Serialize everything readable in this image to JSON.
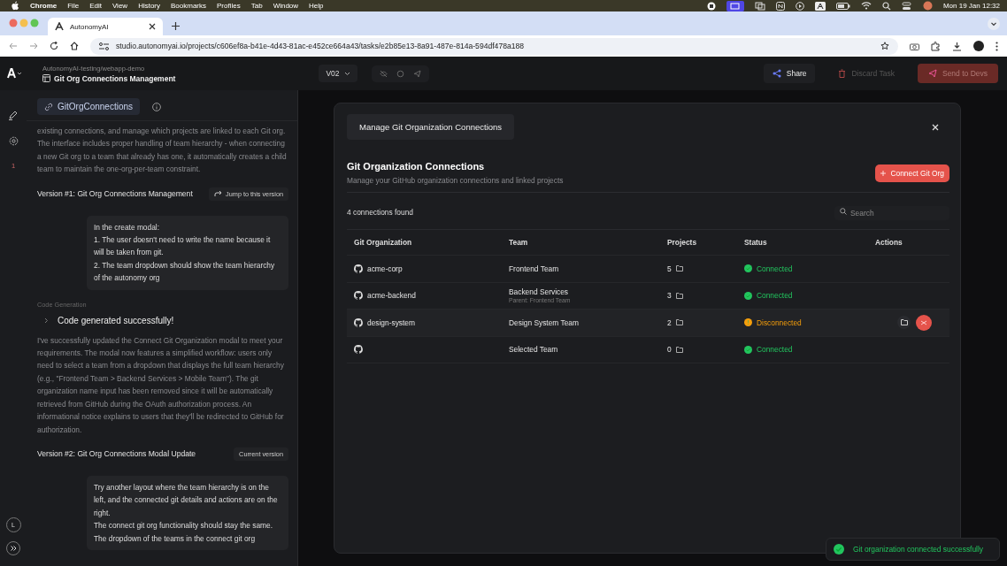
{
  "menu_bar": {
    "app": "Chrome",
    "menus": [
      "File",
      "Edit",
      "View",
      "History",
      "Bookmarks",
      "Profiles",
      "Tab",
      "Window",
      "Help"
    ],
    "clock": "Mon 19 Jan  12:32"
  },
  "browser": {
    "tab_title": "AutonomyAI",
    "url": "studio.autonomyai.io/projects/c606ef8a-b41e-4d43-81ac-e452ce664a43/tasks/e2b85e13-8a91-487e-814a-594df478a188"
  },
  "header": {
    "breadcrumb": "AutonomyAI-testing/webapp-demo",
    "title": "Git Org Connections Management",
    "version": "V02",
    "buttons": [
      {
        "label": "Share",
        "kind": "share",
        "disabled": false
      },
      {
        "label": "Discard Task",
        "kind": "discard",
        "disabled": true
      },
      {
        "label": "Send to Devs",
        "kind": "send",
        "disabled": true
      }
    ]
  },
  "rail": {
    "badge": "1",
    "avatar": "L"
  },
  "sidebar": {
    "chip": "GitOrgConnections",
    "items": [
      {
        "kind": "paragraph",
        "text": "existing connections, and manage which projects are linked to each Git org. The interface includes proper handling of team hierarchy - when connecting a new Git org to a team that already has one, it automatically creates a child team to maintain the one-org-per-team constraint."
      },
      {
        "kind": "version",
        "title": "Version #1: Git Org Connections Management",
        "action": "Jump to this version"
      },
      {
        "kind": "bubble",
        "lines": [
          "In the create modal:",
          "1. The user doesn't need to write the name because it will be taken from git.",
          "2. The team dropdown should show the team hierarchy of the autonomy org"
        ]
      },
      {
        "kind": "label",
        "text": "Code Generation"
      },
      {
        "kind": "status",
        "text": "Code generated successfully!"
      },
      {
        "kind": "paragraph",
        "text": "I've successfully updated the Connect Git Organization modal to meet your requirements. The modal now features a simplified workflow: users only need to select a team from a dropdown that displays the full team hierarchy (e.g., \"Frontend Team > Backend Services > Mobile Team\"). The git organization name input has been removed since it will be automatically retrieved from GitHub during the OAuth authorization process. An informational notice explains to users that they'll be redirected to GitHub for authorization."
      },
      {
        "kind": "version",
        "title": "Version #2: Git Org Connections Modal Update",
        "badge": "Current version"
      },
      {
        "kind": "bubble",
        "lines": [
          "Try another layout where the team hierarchy is on the left, and the connected git details and actions are on the right.",
          "The connect git org functionality should stay the same.",
          "The dropdown of the teams in the connect git org"
        ]
      }
    ]
  },
  "modal": {
    "tab": "Manage Git Organization Connections",
    "title": "Git Organization Connections",
    "subtitle": "Manage your GitHub organization connections and linked projects",
    "connect_button": "Connect Git Org",
    "count": "4 connections found",
    "search": {
      "placeholder": "Search"
    },
    "columns": [
      "Git Organization",
      "Team",
      "Projects",
      "Status",
      "Actions"
    ],
    "rows": [
      {
        "org": "acme-corp",
        "team": "Frontend Team",
        "projects": "5",
        "status": "Connected",
        "kind": "connected",
        "hovered": false
      },
      {
        "org": "acme-backend",
        "team": "Backend Services",
        "parent": "Parent: Frontend Team",
        "projects": "3",
        "status": "Connected",
        "kind": "connected",
        "hovered": false
      },
      {
        "org": "design-system",
        "team": "Design System Team",
        "projects": "2",
        "status": "Disconnected",
        "kind": "disconnected",
        "hovered": true
      },
      {
        "team": "Selected Team",
        "projects": "0",
        "status": "Connected",
        "kind": "connected",
        "hovered": false
      }
    ]
  },
  "toast": {
    "text": "Git organization connected successfully"
  }
}
